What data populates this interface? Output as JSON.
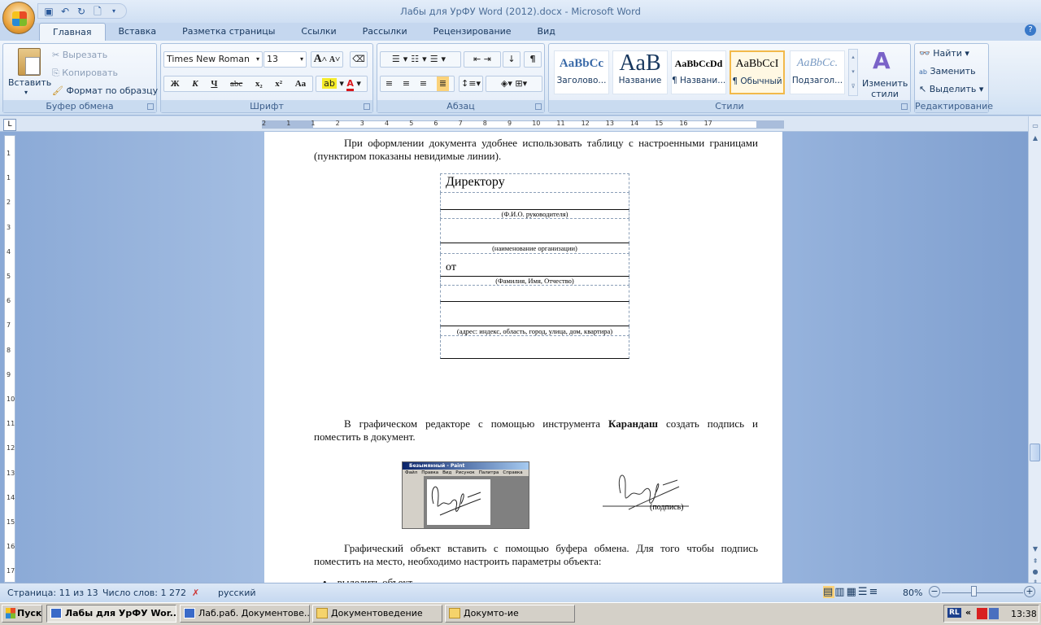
{
  "window": {
    "title": "Лабы для УрФУ Word (2012).docx - Microsoft Word"
  },
  "qat": {
    "icons": [
      "save-icon",
      "undo-icon",
      "redo-icon",
      "print-preview-icon"
    ]
  },
  "tabs": [
    "Главная",
    "Вставка",
    "Разметка страницы",
    "Ссылки",
    "Рассылки",
    "Рецензирование",
    "Вид"
  ],
  "active_tab": "Главная",
  "clipboard": {
    "paste": "Вставить",
    "cut": "Вырезать",
    "copy": "Копировать",
    "format_painter": "Формат по образцу",
    "label": "Буфер обмена"
  },
  "font": {
    "name": "Times New Roman",
    "size": "13",
    "label": "Шрифт",
    "bold": "Ж",
    "italic": "К",
    "underline": "Ч",
    "strike": "abc",
    "sub": "x₂",
    "sup": "x²",
    "case": "Aa",
    "grow": "A",
    "shrink": "A"
  },
  "paragraph": {
    "label": "Абзац",
    "pilcrow": "¶"
  },
  "styles": {
    "label": "Стили",
    "items": [
      {
        "sample": "AaBbCc",
        "name": "Заголово..."
      },
      {
        "sample": "AaB",
        "name": "Название"
      },
      {
        "sample": "AaBbCcDd",
        "name": "¶ Названи..."
      },
      {
        "sample": "AaBbCcI",
        "name": "¶ Обычный"
      },
      {
        "sample": "AaBbCc.",
        "name": "Подзагол..."
      }
    ],
    "selected": "¶ Обычный",
    "change_styles": "Изменить стили"
  },
  "editing": {
    "label": "Редактирование",
    "find": "Найти",
    "replace": "Заменить",
    "select": "Выделить"
  },
  "ruler": {
    "h_numbers": [
      "2",
      "1",
      "1",
      "2",
      "3",
      "4",
      "5",
      "6",
      "7",
      "8",
      "9",
      "10",
      "11",
      "12",
      "13",
      "14",
      "15",
      "16",
      "17"
    ],
    "v_numbers": [
      "1",
      "1",
      "2",
      "3",
      "4",
      "5",
      "6",
      "7",
      "8",
      "9",
      "10",
      "11",
      "12",
      "13",
      "14",
      "15",
      "16",
      "17",
      "18"
    ]
  },
  "document": {
    "para1": "При оформлении документа удобнее использовать таблицу с настроенными границами (пунктиром показаны невидимые линии).",
    "table": {
      "director": "Директору",
      "cap_fio": "(Ф.И.О. руководителя)",
      "cap_org": "(наименование организации)",
      "from": "от",
      "cap_name": "(Фамилия, Имя, Отчество)",
      "cap_address": "(адрес: индекс, область, город, улица, дом, квартира)"
    },
    "para2_before": "В графическом редакторе с помощью инструмента ",
    "para2_bold": "Карандаш",
    "para2_after": " создать подпись и поместить в документ.",
    "paint": {
      "title": "Безымянный - Paint",
      "menu": [
        "Файл",
        "Правка",
        "Вид",
        "Рисунок",
        "Палитра",
        "Справка"
      ]
    },
    "signature_caption": "(подпись)",
    "para3": "Графический объект вставить с помощью буфера обмена. Для того чтобы подпись поместить на место, необходимо настроить параметры объекта:",
    "bullet1": "выделить объект"
  },
  "status": {
    "page": "Страница: 11 из 13",
    "words": "Число слов: 1 272",
    "language": "русский",
    "zoom": "80%",
    "zoom_percent": 80
  },
  "taskbar": {
    "start": "Пуск",
    "tasks": [
      "Лабы для УрФУ Wor...",
      "Лаб.раб. Документове...",
      "Документоведение",
      "Докумто-ие"
    ],
    "lang": "RL",
    "time": "13:38"
  }
}
